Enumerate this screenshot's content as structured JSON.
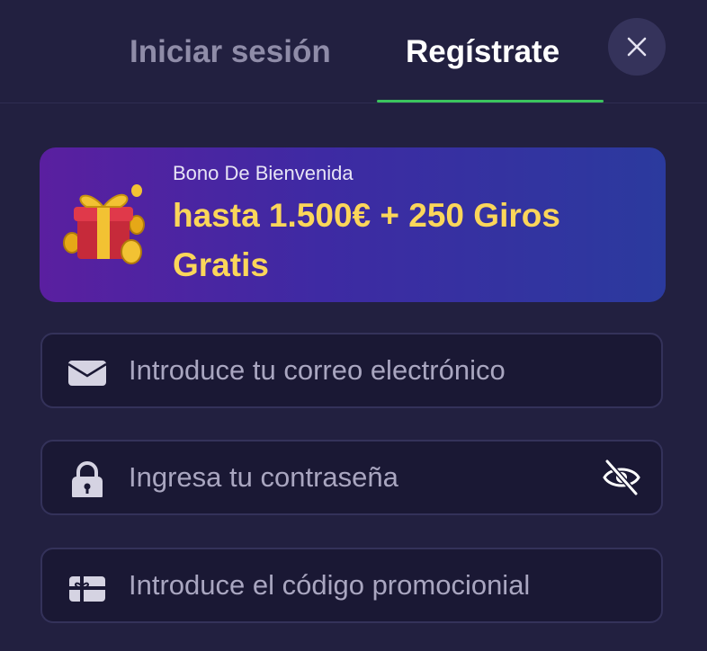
{
  "tabs": {
    "login_label": "Iniciar sesión",
    "register_label": "Regístrate",
    "active": "register"
  },
  "banner": {
    "subtitle": "Bono De Bienvenida",
    "title": "hasta 1.500€ + 250 Giros Gratis",
    "icon": "gift-icon"
  },
  "form": {
    "email": {
      "placeholder": "Introduce tu correo electrónico",
      "value": "",
      "icon": "envelope-icon"
    },
    "password": {
      "placeholder": "Ingresa tu contraseña",
      "value": "",
      "icon": "lock-icon",
      "toggle_icon": "eye-slash-icon"
    },
    "promo": {
      "placeholder": "Introduce el código promocionial",
      "value": "",
      "icon": "gift-card-icon"
    }
  },
  "colors": {
    "background": "#222040",
    "accent_underline": "#3bc45e",
    "banner_title": "#fbd65a",
    "field_background": "#1a1834"
  }
}
